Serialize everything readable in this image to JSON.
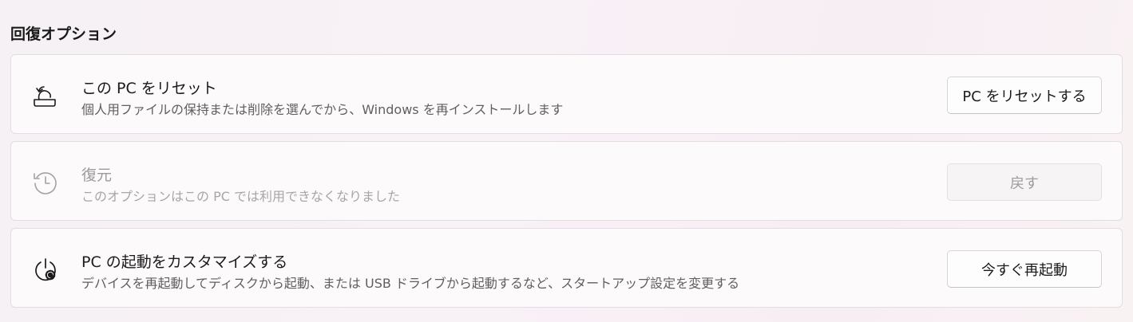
{
  "section": {
    "title": "回復オプション"
  },
  "items": [
    {
      "title": "この PC をリセット",
      "description": "個人用ファイルの保持または削除を選んでから、Windows を再インストールします",
      "button": "PC をリセットする",
      "icon": "reset-pc-icon",
      "enabled": true
    },
    {
      "title": "復元",
      "description": "このオプションはこの PC では利用できなくなりました",
      "button": "戻す",
      "icon": "history-icon",
      "enabled": false
    },
    {
      "title": "PC の起動をカスタマイズする",
      "description": "デバイスを再起動してディスクから起動、または USB ドライブから起動するなど、スタートアップ設定を変更する",
      "button": "今すぐ再起動",
      "icon": "power-settings-icon",
      "enabled": true
    }
  ]
}
